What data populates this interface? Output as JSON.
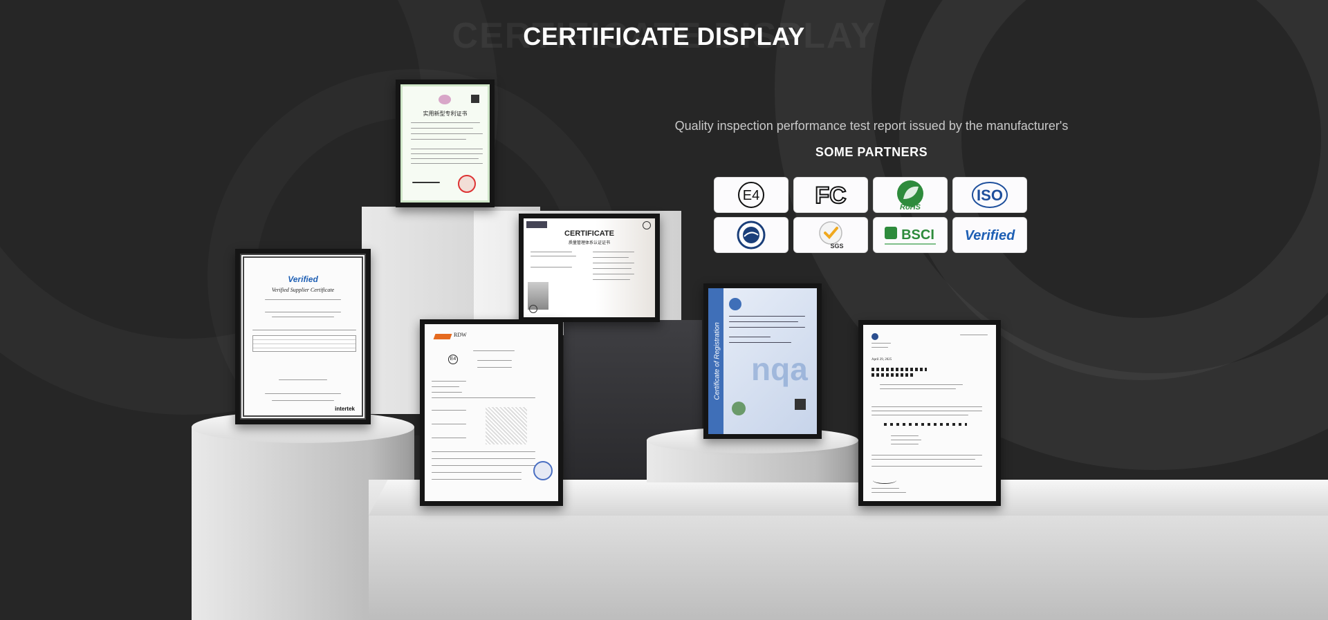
{
  "page": {
    "title": "CERTIFICATE DISPLAY",
    "subtitle": "Quality inspection performance test report issued by the manufacturer's",
    "partners_label": "SOME PARTNERS"
  },
  "partners": [
    {
      "name": "E4",
      "icon": "e4-mark-icon"
    },
    {
      "name": "FC",
      "icon": "fcc-logo-icon"
    },
    {
      "name": "RoHS",
      "icon": "rohs-leaf-icon"
    },
    {
      "name": "ISO",
      "icon": "iso-logo-icon"
    },
    {
      "name": "",
      "icon": "dot-seal-icon"
    },
    {
      "name": "SGS",
      "icon": "sgs-check-icon"
    },
    {
      "name": "BSCI",
      "icon": "bsci-logo-icon"
    },
    {
      "name": "Verified",
      "icon": "verified-logo-icon"
    }
  ],
  "certificates": {
    "patent": {
      "heading": "实用新型专利证书"
    },
    "quality": {
      "heading": "CERTIFICATE",
      "subheading": "质量管理体系认证证书"
    },
    "verified": {
      "brand": "Verified",
      "heading": "Verified Supplier Certificate",
      "footer_brand": "intertek"
    },
    "rdw": {
      "brand": "RDW",
      "mark": "E4"
    },
    "nqa": {
      "side_text": "Certificate of Registration",
      "brand": "nqa"
    },
    "fda": {
      "date": "April 29, 2025"
    }
  },
  "colors": {
    "background": "#262626",
    "accent_blue": "#1e5fb4",
    "rohs_green": "#2e8b3c"
  }
}
